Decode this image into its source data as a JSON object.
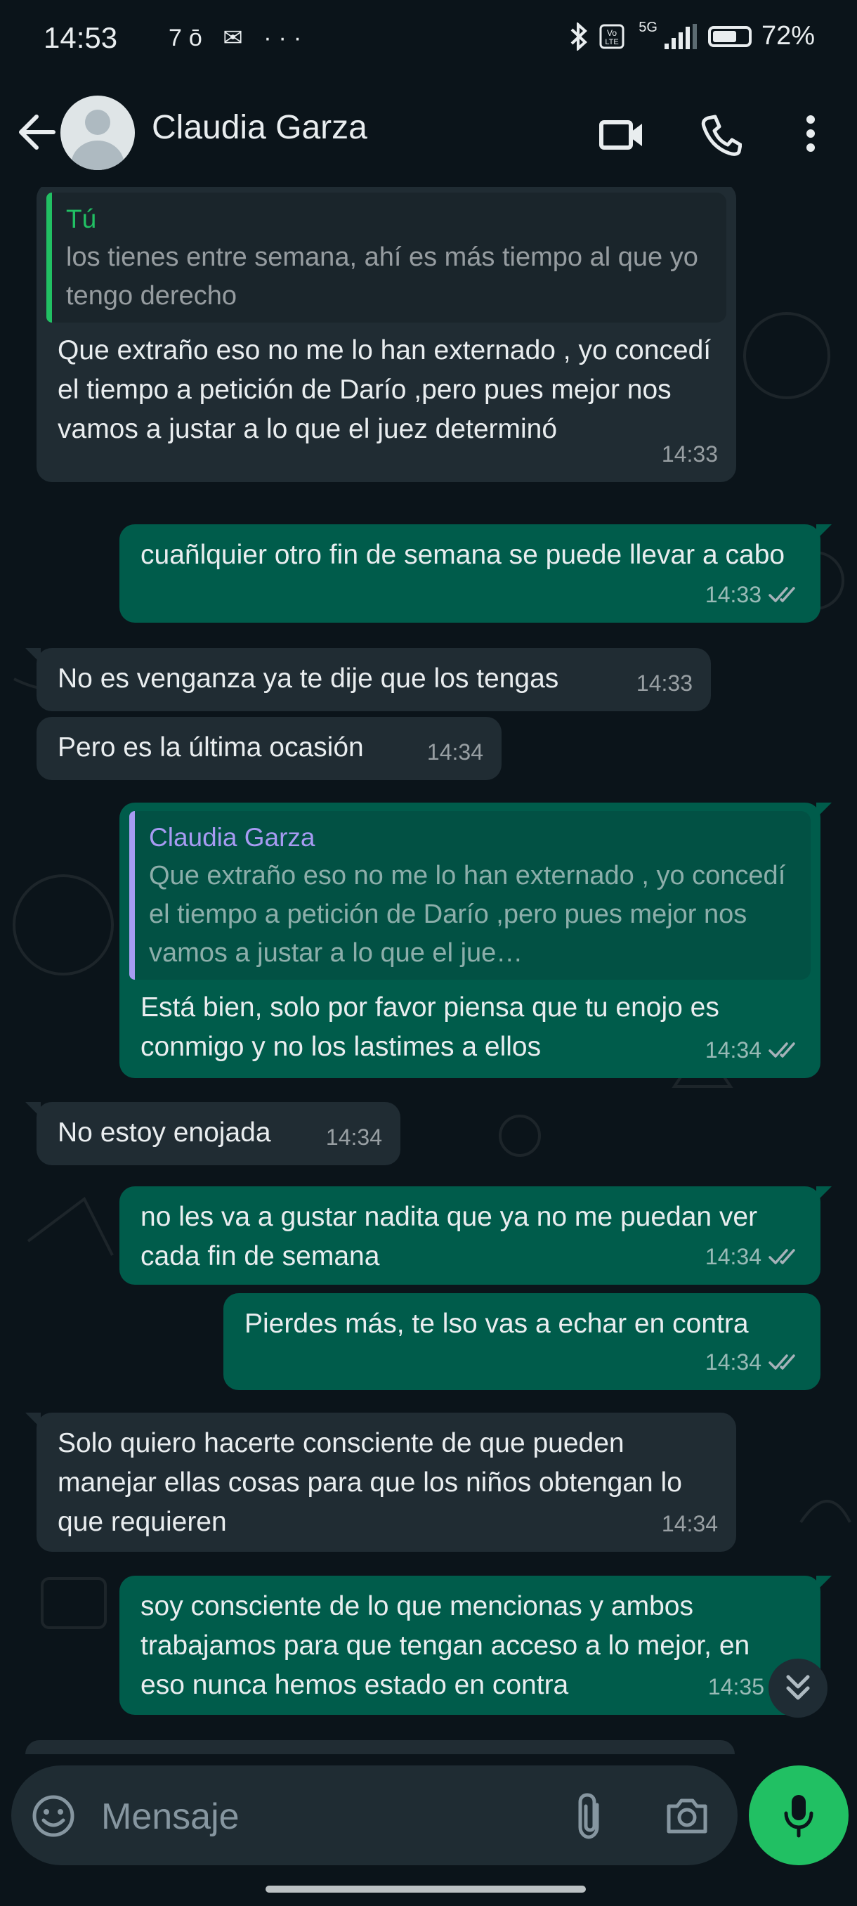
{
  "status_bar": {
    "time": "14:53",
    "left_icons": "7ō ✉ ···",
    "network": "5G",
    "battery_percent": "72%",
    "battery_level": 0.72
  },
  "header": {
    "contact_name": "Claudia Garza",
    "icons": [
      "back-arrow-icon",
      "avatar",
      "video-call-icon",
      "voice-call-icon",
      "more-options-icon"
    ]
  },
  "colors": {
    "incoming_bubble": "#202c33",
    "outgoing_bubble": "#005c4b",
    "quote_you": "#21c063",
    "quote_contact": "#a79bf2",
    "mic_button": "#21c063",
    "read_ticks": "#a6b2b9"
  },
  "messages": [
    {
      "direction": "in",
      "quote": {
        "author": "Tú",
        "text": "los tienes entre semana, ahí es más tiempo al que yo tengo derecho"
      },
      "text": "Que extraño eso no me lo han externado , yo concedí el tiempo a petición de Darío ,pero pues mejor nos vamos a justar a lo que el juez determinó",
      "time": "14:33"
    },
    {
      "direction": "out",
      "text": "cuañlquier otro fin de semana se puede llevar a cabo",
      "time": "14:33",
      "read": true
    },
    {
      "direction": "in",
      "text": "No es venganza ya te dije que los tengas",
      "time": "14:33"
    },
    {
      "direction": "in",
      "text": "Pero es la última ocasión",
      "time": "14:34"
    },
    {
      "direction": "out",
      "quote": {
        "author": "Claudia Garza",
        "text": "Que extraño eso no me lo han externado , yo concedí el tiempo a petición de Darío ,pero pues mejor nos vamos a justar a lo que el jue…"
      },
      "text": "Está bien, solo por favor piensa que tu enojo es conmigo y no los lastimes a ellos",
      "time": "14:34",
      "read": true
    },
    {
      "direction": "in",
      "text": "No estoy enojada",
      "time": "14:34"
    },
    {
      "direction": "out",
      "text": "no les va a gustar nadita que ya no me puedan ver cada fin de semana",
      "time": "14:34",
      "read": true
    },
    {
      "direction": "out",
      "text": "Pierdes más, te lso vas a echar en contra",
      "time": "14:34",
      "read": true
    },
    {
      "direction": "in",
      "text": "Solo quiero hacerte consciente de que pueden manejar ellas cosas para que los niños obtengan lo que requieren",
      "time": "14:34"
    },
    {
      "direction": "out",
      "text": "soy consciente de lo que mencionas y ambos trabajamos para que tengan acceso a lo mejor, en eso nunca hemos estado en contra",
      "time": "14:35"
    }
  ],
  "composer": {
    "placeholder": "Mensaje",
    "icons": [
      "emoji-icon",
      "attach-icon",
      "camera-icon",
      "mic-icon"
    ]
  }
}
